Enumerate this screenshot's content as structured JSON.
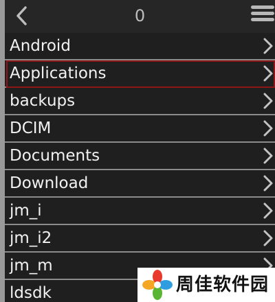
{
  "header": {
    "title": "0",
    "back_icon": "chevron-left-icon",
    "menu_icon": "hamburger-menu-icon"
  },
  "folders": [
    {
      "name": "Android"
    },
    {
      "name": "Applications",
      "selected": true
    },
    {
      "name": "backups"
    },
    {
      "name": "DCIM"
    },
    {
      "name": "Documents"
    },
    {
      "name": "Download"
    },
    {
      "name": "jm_i"
    },
    {
      "name": "jm_i2"
    },
    {
      "name": "jm_m"
    },
    {
      "name": "ldsdk"
    }
  ],
  "row_icon": "chevron-right-icon",
  "watermark": {
    "text": "周佳软件园",
    "logo_icon": "pinwheel-logo-icon"
  },
  "colors": {
    "background": "#1f1f1f",
    "divider": "#8c8c8c",
    "selected_outline": "#8e1616",
    "text": "#f2f2f2",
    "icon": "#bdbdbd"
  }
}
